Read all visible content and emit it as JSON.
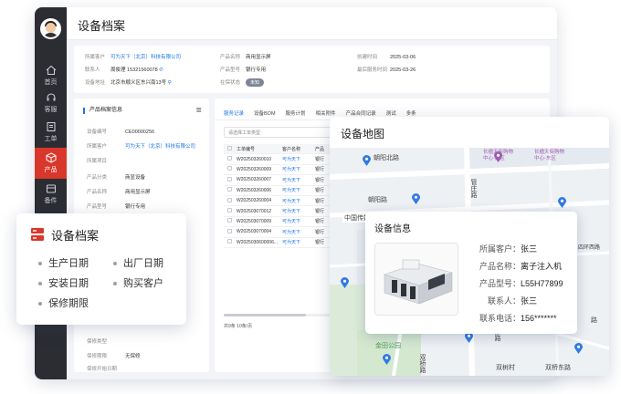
{
  "app": {
    "page_title": "设备档案",
    "nav": [
      {
        "label": "首页",
        "icon": "home-icon"
      },
      {
        "label": "客服",
        "icon": "headset-icon"
      },
      {
        "label": "工单",
        "icon": "ticket-icon"
      },
      {
        "label": "产品",
        "icon": "box-icon",
        "active": true
      },
      {
        "label": "备件",
        "icon": "parts-icon"
      }
    ],
    "info": [
      {
        "k": "所属客户",
        "v": "可为天下（北京）科技有限公司",
        "link": true
      },
      {
        "k": "联系人",
        "v": "周俊理 15321560078"
      },
      {
        "k": "设备地址",
        "v": "北京市顺义区东兴南13号"
      },
      {
        "k": "产品名称",
        "v": "商用显示屏"
      },
      {
        "k": "产品型号",
        "v": "银行专用"
      },
      {
        "k": "在保状态",
        "v": "未知"
      },
      {
        "k": "创建时间",
        "v": "2025-03-06"
      },
      {
        "k": "最后服务时间",
        "v": "2025-03-26"
      }
    ],
    "left_panel": {
      "title": "产品档案信息",
      "rows": [
        {
          "k": "设备编号",
          "v": "CE00000256"
        },
        {
          "k": "所属客户",
          "v": "可为天下（北京）科技有限公司",
          "link": true
        },
        {
          "k": "所属项目",
          "v": ""
        },
        {
          "k": "产品分类",
          "v": "商显设备"
        },
        {
          "k": "产品名称",
          "v": "商用显示屏"
        },
        {
          "k": "产品型号",
          "v": "银行专用"
        }
      ],
      "bottom_rows": [
        {
          "k": "保修类型",
          "v": ""
        },
        {
          "k": "保修期限",
          "v": "无保修"
        },
        {
          "k": "保修开始日期",
          "v": ""
        }
      ]
    },
    "right_panel": {
      "tabs": [
        "服务记录",
        "设备BOM",
        "服务计划",
        "相关附件",
        "产品合同记录",
        "测试",
        "多条"
      ],
      "filter_placeholder": "请选择工单类型",
      "columns": [
        "工单编号",
        "客户名称",
        "产品"
      ],
      "rows": [
        [
          "W202503260010",
          "可为天下",
          "银行"
        ],
        [
          "W202503260009",
          "可为天下",
          "银行"
        ],
        [
          "W202503260007",
          "可为天下",
          "银行"
        ],
        [
          "W202503260006",
          "可为天下",
          "银行"
        ],
        [
          "W202503260004",
          "可为天下",
          "银行"
        ],
        [
          "W202503070012",
          "可为天下",
          "银行"
        ],
        [
          "W202503070009",
          "可为天下",
          "银行"
        ],
        [
          "W202503070004",
          "可为天下",
          "银行"
        ],
        [
          "W2025030600006...",
          "可为天下",
          "银行"
        ]
      ],
      "pager": "共9条    10条/页"
    }
  },
  "archive_card": {
    "title": "设备档案",
    "features": [
      "生产日期",
      "出厂日期",
      "安装日期",
      "购买客户",
      "保修期限"
    ]
  },
  "map_card": {
    "title": "设备地图",
    "roads": [
      "朝阳北路",
      "朝阳路",
      "管庄路",
      "双桥路",
      "中国传媒",
      "四环西路",
      "路",
      "东路",
      "金田公园",
      "双树村",
      "双桥东路"
    ],
    "pois": [
      "长楹天街购物\n中心-西区",
      "长楹天街购物\n中心-东区"
    ],
    "popup": {
      "title": "设备信息",
      "rows": [
        {
          "k": "所属客户：",
          "v": "张三"
        },
        {
          "k": "产品名称：",
          "v": "离子注入机"
        },
        {
          "k": "产品型号：",
          "v": "L55H77899"
        },
        {
          "k": "联系人：",
          "v": "张三"
        },
        {
          "k": "联系电话：",
          "v": "156*******"
        }
      ]
    }
  },
  "colors": {
    "accent": "#1a73e8",
    "nav_active": "#d9372b",
    "sidebar": "#2b2d33"
  }
}
